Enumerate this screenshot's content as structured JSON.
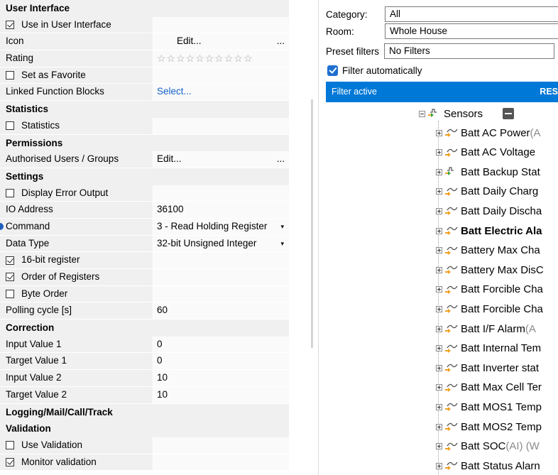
{
  "properties": {
    "groups": [
      {
        "title": "User Interface",
        "rows": [
          {
            "label": "Use in User Interface",
            "checkbox": true,
            "checked": true,
            "value": ""
          },
          {
            "label": "Icon",
            "value": "Edit...",
            "ellipsis": "...",
            "value_style": "center"
          },
          {
            "label": "Rating",
            "stars": "☆☆☆☆☆☆☆☆☆☆"
          },
          {
            "label": "Set as Favorite",
            "checkbox": true,
            "checked": false,
            "value": ""
          },
          {
            "label": "Linked Function Blocks",
            "value": "Select...",
            "value_style": "link"
          }
        ]
      },
      {
        "title": "Statistics",
        "rows": [
          {
            "label": "Statistics",
            "checkbox": true,
            "checked": false,
            "value": ""
          }
        ]
      },
      {
        "title": "Permissions",
        "rows": [
          {
            "label": "Authorised Users / Groups",
            "value": "Edit...",
            "ellipsis": "..."
          }
        ]
      },
      {
        "title": "Settings",
        "rows": [
          {
            "label": "Display Error Output",
            "checkbox": true,
            "checked": false,
            "value": ""
          },
          {
            "label": "IO Address",
            "value": "36100"
          },
          {
            "label": "Command",
            "value": "3 - Read Holding Register",
            "dropdown": "▾",
            "marker": true
          },
          {
            "label": "Data Type",
            "value": "32-bit Unsigned Integer",
            "dropdown": "▾"
          },
          {
            "label": "16-bit register",
            "checkbox": true,
            "checked": true,
            "value": ""
          },
          {
            "label": "Order of Registers",
            "checkbox": true,
            "checked": true,
            "value": ""
          },
          {
            "label": "Byte Order",
            "checkbox": true,
            "checked": false,
            "value": ""
          },
          {
            "label": "Polling cycle [s]",
            "value": "60"
          }
        ]
      },
      {
        "title": "Correction",
        "rows": [
          {
            "label": "Input Value 1",
            "value": "0"
          },
          {
            "label": "Target Value 1",
            "value": "0"
          },
          {
            "label": "Input Value 2",
            "value": "10"
          },
          {
            "label": "Target Value 2",
            "value": "10"
          }
        ]
      },
      {
        "title": "Logging/Mail/Call/Track",
        "rows": []
      },
      {
        "title": "Validation",
        "rows": [
          {
            "label": "Use Validation",
            "checkbox": true,
            "checked": false,
            "value": ""
          },
          {
            "label": "Monitor validation",
            "checkbox": true,
            "checked": true,
            "value": ""
          }
        ]
      }
    ]
  },
  "filters": {
    "category_label": "Category:",
    "category_value": "All",
    "room_label": "Room:",
    "room_value": "Whole House",
    "preset_label": "Preset filters",
    "preset_value": "No Filters",
    "auto_label": "Filter automatically",
    "banner_text": "Filter active",
    "reset_label": "RES"
  },
  "tree": {
    "root": {
      "label": "Sensors",
      "icon": "digital-sensor-icon"
    },
    "items": [
      {
        "label": "Batt AC Power",
        "suffix": " (A",
        "icon": "analog-sensor-icon"
      },
      {
        "label": "Batt AC Voltage",
        "suffix": "",
        "icon": "analog-sensor-icon"
      },
      {
        "label": "Batt Backup Stat",
        "suffix": "",
        "icon": "digital-sensor-icon"
      },
      {
        "label": "Batt Daily Charg",
        "suffix": "",
        "icon": "analog-sensor-icon"
      },
      {
        "label": "Batt Daily Discha",
        "suffix": "",
        "icon": "analog-sensor-icon"
      },
      {
        "label": "Batt Electric Ala",
        "suffix": "",
        "icon": "analog-sensor-icon",
        "bold": true
      },
      {
        "label": "Battery Max Cha",
        "suffix": "",
        "icon": "analog-sensor-icon"
      },
      {
        "label": "Battery Max DisC",
        "suffix": "",
        "icon": "analog-sensor-icon"
      },
      {
        "label": "Batt Forcible Cha",
        "suffix": "",
        "icon": "analog-sensor-icon"
      },
      {
        "label": "Batt Forcible Cha",
        "suffix": "",
        "icon": "analog-sensor-icon"
      },
      {
        "label": "Batt I/F Alarm",
        "suffix": " (A",
        "icon": "analog-sensor-icon"
      },
      {
        "label": "Batt Internal Tem",
        "suffix": "",
        "icon": "analog-sensor-icon"
      },
      {
        "label": "Batt Inverter stat",
        "suffix": "",
        "icon": "analog-sensor-icon"
      },
      {
        "label": "Batt Max Cell Ter",
        "suffix": "",
        "icon": "analog-sensor-icon"
      },
      {
        "label": "Batt MOS1 Temp",
        "suffix": "",
        "icon": "analog-sensor-icon"
      },
      {
        "label": "Batt MOS2 Temp",
        "suffix": "",
        "icon": "analog-sensor-icon"
      },
      {
        "label": "Batt SOC",
        "suffix": " (AI) (W",
        "icon": "analog-sensor-icon"
      },
      {
        "label": "Batt Status Alarn",
        "suffix": "",
        "icon": "analog-sensor-icon"
      }
    ]
  },
  "colors": {
    "accent": "#0078d7",
    "link": "#1463c8",
    "group_bg": "#f0f0f0"
  }
}
